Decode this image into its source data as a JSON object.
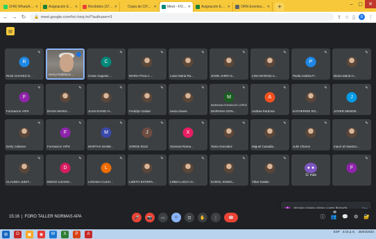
{
  "browser": {
    "tabs": [
      {
        "label": "(249) WhatsApp",
        "color": "#25d366"
      },
      {
        "label": "Asignación Exp...",
        "color": "#188038"
      },
      {
        "label": "Recibidos (3745)...",
        "color": "#ea4335"
      },
      {
        "label": "Copia de CHECKLI...",
        "color": "#f6c83a"
      },
      {
        "label": "Meet - FORO T...",
        "color": "#00897b",
        "active": true
      },
      {
        "label": "Asignación Exp...",
        "color": "#188038"
      },
      {
        "label": "ORN Eventos...",
        "color": "#5f6368"
      }
    ],
    "url": "meet.google.com/hci-hxoj-hcf?authuser=3",
    "new_tab": "+",
    "profile_initial": "D"
  },
  "participants": [
    {
      "name": "RUIZ CHAVEZ D...",
      "type": "initial",
      "initial": "R",
      "color": "#1e88e5"
    },
    {
      "name": "Henry Robinson ...",
      "type": "speaker"
    },
    {
      "name": "Cesar Augusto ...",
      "type": "initial",
      "initial": "C",
      "color": "#00897b"
    },
    {
      "name": "MARIA PAULA ...",
      "type": "photo"
    },
    {
      "name": "Luisa Maria Ra...",
      "type": "photo"
    },
    {
      "name": "JHON JAIRO S...",
      "type": "photo"
    },
    {
      "name": "LINA MARCELA...",
      "type": "photo"
    },
    {
      "name": "Paola Andrea P...",
      "type": "initial",
      "initial": "P",
      "color": "#1e88e5"
    },
    {
      "name": "Diana Maria H...",
      "type": "photo"
    },
    {
      "name": "Formacion VIPS",
      "type": "initial",
      "initial": "F",
      "color": "#8e24aa"
    },
    {
      "name": "DIANA MARIA ...",
      "type": "photo"
    },
    {
      "name": "JUAN DAVID H...",
      "type": "photo"
    },
    {
      "name": "Freddyn Gaitan",
      "type": "photo"
    },
    {
      "name": "nevia claves",
      "type": "photo"
    },
    {
      "name": "MARIANA GON...",
      "type": "initial",
      "initial": "M",
      "color": "#1b5e20",
      "sublabel": "MARIANA GONZÁLEZ LOPEZ"
    },
    {
      "name": "Andrea Pardona",
      "type": "initial",
      "initial": "A",
      "color": "#f4511e"
    },
    {
      "name": "KATHERINE RO...",
      "type": "photo"
    },
    {
      "name": "JOVER MENDE...",
      "type": "initial",
      "initial": "J",
      "color": "#039be5"
    },
    {
      "name": "Derly Cabrera",
      "type": "photo"
    },
    {
      "name": "Formacion VIPS",
      "type": "initial",
      "initial": "F",
      "color": "#8e24aa"
    },
    {
      "name": "MARTHA ISABE...",
      "type": "initial",
      "initial": "M",
      "color": "#3949ab"
    },
    {
      "name": "JORGE RUIZ",
      "type": "initial",
      "initial": "J",
      "color": "#6d4c41"
    },
    {
      "name": "Xiomara Rama...",
      "type": "initial",
      "initial": "X",
      "color": "#e91e63"
    },
    {
      "name": "Tania Gonzalez",
      "type": "photo"
    },
    {
      "name": "Miguel Casadia...",
      "type": "photo"
    },
    {
      "name": "Julie Charon",
      "type": "photo"
    },
    {
      "name": "mauri al maestro...",
      "type": "photo"
    },
    {
      "name": "CLAUDIA JUDIT...",
      "type": "photo"
    },
    {
      "name": "DIEGO LIZANO...",
      "type": "initial",
      "initial": "D",
      "color": "#d81b60"
    },
    {
      "name": "LOSADA CUCH...",
      "type": "initial",
      "initial": "L",
      "color": "#ef6c00"
    },
    {
      "name": "LIZETH ESTEPA...",
      "type": "photo"
    },
    {
      "name": "LINDA LUCIA VI...",
      "type": "photo"
    },
    {
      "name": "KAROL XIOMA...",
      "type": "photo"
    },
    {
      "name": "Yibar Gaitan",
      "type": "photo"
    },
    {
      "name": "",
      "type": "more",
      "more_label": "11 más"
    },
    {
      "name": "",
      "type": "initial",
      "initial": "F",
      "color": "#8e24aa"
    }
  ],
  "notification": {
    "avatar": "A",
    "text": "Alguien quiere unirse a esta llamada",
    "button": "Ver"
  },
  "reactions": [
    "💖",
    "👍",
    "🎉",
    "👏",
    "😂",
    "😮",
    "😢",
    "🤔",
    "👎"
  ],
  "meeting": {
    "time": "15:16",
    "separator": "|",
    "title": "FORO TALLER NORMAS APA"
  },
  "controls": {
    "mic": "mic-off",
    "camera": "cam-off",
    "captions": "CC",
    "emoji": "emoji",
    "present": "present",
    "raise_hand": "hand",
    "more": "⋮",
    "end": "end-call",
    "chat_count": "45"
  },
  "taskbar": {
    "time": "3:16 p.m.",
    "date": "25/04/2023",
    "lang": "ESP"
  }
}
